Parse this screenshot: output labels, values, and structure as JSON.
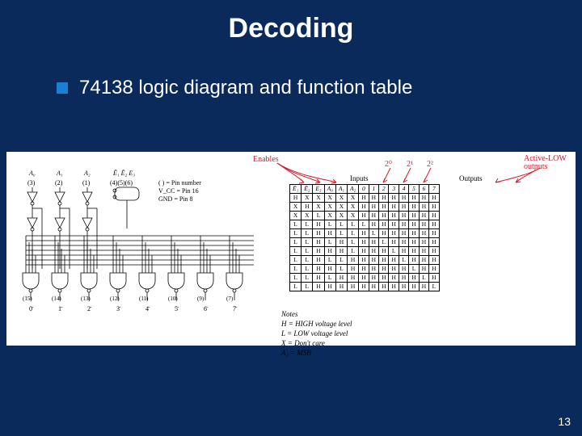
{
  "slide": {
    "title": "Decoding",
    "body": "74138 logic diagram and function table",
    "page": "13"
  },
  "figure": {
    "annot": {
      "enables": "Enables",
      "inputs": "Inputs",
      "outputs": "Outputs",
      "active_low": "Active-LOW outputs",
      "p20": "2⁰",
      "p21": "2¹",
      "p22": "2²"
    },
    "schematic": {
      "top_labels": [
        "A₀",
        "A₁",
        "A₂",
        "Ē₁  Ē₂ E₃"
      ],
      "top_pins": [
        "(3)",
        "(2)",
        "(1)",
        "(4)(5)(6)"
      ],
      "side_text": [
        "( ) = Pin number",
        "V_CC = Pin 16",
        "GND = Pin 8"
      ],
      "out_pins": [
        "(15)",
        "(14)",
        "(13)",
        "(12)",
        "(11)",
        "(10)",
        "(9)",
        "(7)"
      ],
      "out_labels": [
        "0̄",
        "1̄",
        "2̄",
        "3̄",
        "4̄",
        "5̄",
        "6̄",
        "7̄"
      ]
    },
    "table": {
      "headers_in": [
        "Ē₁",
        "Ē₂",
        "E₃",
        "A₀",
        "A₁",
        "A₂"
      ],
      "headers_out": [
        "0",
        "1",
        "2",
        "3",
        "4",
        "5",
        "6",
        "7"
      ],
      "rows": [
        [
          "H",
          "X",
          "X",
          "X",
          "X",
          "X",
          "H",
          "H",
          "H",
          "H",
          "H",
          "H",
          "H",
          "H"
        ],
        [
          "X",
          "H",
          "X",
          "X",
          "X",
          "X",
          "H",
          "H",
          "H",
          "H",
          "H",
          "H",
          "H",
          "H"
        ],
        [
          "X",
          "X",
          "L",
          "X",
          "X",
          "X",
          "H",
          "H",
          "H",
          "H",
          "H",
          "H",
          "H",
          "H"
        ],
        [
          "L",
          "L",
          "H",
          "L",
          "L",
          "L",
          "L",
          "H",
          "H",
          "H",
          "H",
          "H",
          "H",
          "H"
        ],
        [
          "L",
          "L",
          "H",
          "H",
          "L",
          "L",
          "H",
          "L",
          "H",
          "H",
          "H",
          "H",
          "H",
          "H"
        ],
        [
          "L",
          "L",
          "H",
          "L",
          "H",
          "L",
          "H",
          "H",
          "L",
          "H",
          "H",
          "H",
          "H",
          "H"
        ],
        [
          "L",
          "L",
          "H",
          "H",
          "H",
          "L",
          "H",
          "H",
          "H",
          "L",
          "H",
          "H",
          "H",
          "H"
        ],
        [
          "L",
          "L",
          "H",
          "L",
          "L",
          "H",
          "H",
          "H",
          "H",
          "H",
          "L",
          "H",
          "H",
          "H"
        ],
        [
          "L",
          "L",
          "H",
          "H",
          "L",
          "H",
          "H",
          "H",
          "H",
          "H",
          "H",
          "L",
          "H",
          "H"
        ],
        [
          "L",
          "L",
          "H",
          "L",
          "H",
          "H",
          "H",
          "H",
          "H",
          "H",
          "H",
          "H",
          "L",
          "H"
        ],
        [
          "L",
          "L",
          "H",
          "H",
          "H",
          "H",
          "H",
          "H",
          "H",
          "H",
          "H",
          "H",
          "H",
          "L"
        ]
      ]
    },
    "notes": {
      "title": "Notes",
      "l1": "H = HIGH voltage level",
      "l2": "L = LOW voltage level",
      "l3": "X = Don't care",
      "l4": "A₂ = MSB"
    }
  }
}
